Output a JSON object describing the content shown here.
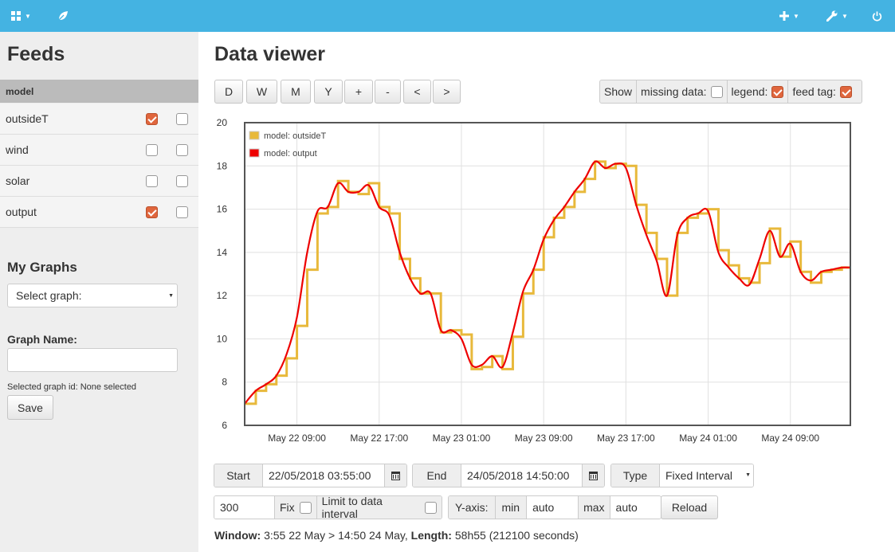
{
  "topbar": {
    "left_icons": [
      "dashboard-grid-icon",
      "leaf-icon"
    ],
    "right_icons": [
      "plus-icon",
      "wrench-icon",
      "power-icon"
    ]
  },
  "sidebar": {
    "title": "Feeds",
    "group": "model",
    "feeds": [
      {
        "name": "outsideT",
        "left_checked": true,
        "right_checked": false
      },
      {
        "name": "wind",
        "left_checked": false,
        "right_checked": false
      },
      {
        "name": "solar",
        "left_checked": false,
        "right_checked": false
      },
      {
        "name": "output",
        "left_checked": true,
        "right_checked": false
      }
    ],
    "my_graphs_title": "My Graphs",
    "select_graph_value": "Select graph:",
    "graph_name_label": "Graph Name:",
    "graph_name_value": "",
    "selected_graph_id": "Selected graph id: None selected",
    "save_label": "Save"
  },
  "main": {
    "title": "Data viewer",
    "range_buttons": [
      "D",
      "W",
      "M",
      "Y",
      "+",
      "-",
      "<",
      ">"
    ],
    "show_label": "Show",
    "missing_data_label": "missing data:",
    "missing_data_checked": false,
    "legend_label": "legend:",
    "legend_checked": true,
    "feed_tag_label": "feed tag:",
    "feed_tag_checked": true
  },
  "chart_data": {
    "type": "line",
    "title": "",
    "xlabel": "",
    "ylabel": "",
    "ylim": [
      6,
      20
    ],
    "yticks": [
      6,
      8,
      10,
      12,
      14,
      16,
      18,
      20
    ],
    "xlim": [
      "May 22 03:55",
      "May 24 14:50"
    ],
    "xticks": [
      "May 22 09:00",
      "May 22 17:00",
      "May 23 01:00",
      "May 23 09:00",
      "May 23 17:00",
      "May 24 01:00",
      "May 24 09:00"
    ],
    "legend_position": "top-left",
    "grid": true,
    "series": [
      {
        "name": "model: outsideT",
        "color": "#e8b93b",
        "style": "step",
        "x": [
          "May 22 03:55",
          "May 22 05:00",
          "May 22 06:00",
          "May 22 07:00",
          "May 22 08:00",
          "May 22 09:00",
          "May 22 10:00",
          "May 22 11:00",
          "May 22 12:00",
          "May 22 13:00",
          "May 22 14:00",
          "May 22 15:00",
          "May 22 16:00",
          "May 22 17:00",
          "May 22 18:00",
          "May 22 19:00",
          "May 22 20:00",
          "May 22 21:00",
          "May 22 22:00",
          "May 22 23:00",
          "May 23 00:00",
          "May 23 01:00",
          "May 23 02:00",
          "May 23 03:00",
          "May 23 04:00",
          "May 23 05:00",
          "May 23 06:00",
          "May 23 07:00",
          "May 23 08:00",
          "May 23 09:00",
          "May 23 10:00",
          "May 23 11:00",
          "May 23 12:00",
          "May 23 13:00",
          "May 23 14:00",
          "May 23 15:00",
          "May 23 16:00",
          "May 23 17:00",
          "May 23 18:00",
          "May 23 19:00",
          "May 23 20:00",
          "May 23 21:00",
          "May 23 22:00",
          "May 23 23:00",
          "May 24 00:00",
          "May 24 01:00",
          "May 24 02:00",
          "May 24 03:00",
          "May 24 04:00",
          "May 24 05:00",
          "May 24 06:00",
          "May 24 07:00",
          "May 24 08:00",
          "May 24 09:00",
          "May 24 10:00",
          "May 24 11:00",
          "May 24 12:00",
          "May 24 13:00",
          "May 24 14:00",
          "May 24 14:50"
        ],
        "y": [
          7.0,
          7.6,
          7.9,
          8.3,
          9.1,
          10.6,
          13.2,
          15.8,
          16.1,
          17.3,
          16.8,
          16.7,
          17.2,
          16.1,
          15.8,
          13.7,
          12.8,
          12.1,
          12.1,
          10.3,
          10.4,
          10.2,
          8.6,
          8.7,
          9.2,
          8.6,
          10.1,
          12.1,
          13.2,
          14.7,
          15.6,
          16.1,
          16.8,
          17.4,
          18.2,
          17.9,
          18.1,
          18.0,
          16.2,
          14.9,
          13.7,
          12.0,
          14.9,
          15.6,
          15.8,
          16.0,
          14.1,
          13.4,
          12.8,
          12.6,
          13.5,
          15.1,
          13.8,
          14.5,
          13.1,
          12.6,
          13.1,
          13.2,
          13.3,
          13.3
        ]
      },
      {
        "name": "model: output",
        "color": "#ee0000",
        "style": "line",
        "x": [
          "May 22 03:55",
          "May 22 05:00",
          "May 22 06:00",
          "May 22 07:00",
          "May 22 08:00",
          "May 22 09:00",
          "May 22 10:00",
          "May 22 11:00",
          "May 22 12:00",
          "May 22 13:00",
          "May 22 14:00",
          "May 22 15:00",
          "May 22 16:00",
          "May 22 17:00",
          "May 22 18:00",
          "May 22 19:00",
          "May 22 20:00",
          "May 22 21:00",
          "May 22 22:00",
          "May 22 23:00",
          "May 23 00:00",
          "May 23 01:00",
          "May 23 02:00",
          "May 23 03:00",
          "May 23 04:00",
          "May 23 05:00",
          "May 23 06:00",
          "May 23 07:00",
          "May 23 08:00",
          "May 23 09:00",
          "May 23 10:00",
          "May 23 11:00",
          "May 23 12:00",
          "May 23 13:00",
          "May 23 14:00",
          "May 23 15:00",
          "May 23 16:00",
          "May 23 17:00",
          "May 23 18:00",
          "May 23 19:00",
          "May 23 20:00",
          "May 23 21:00",
          "May 23 22:00",
          "May 23 23:00",
          "May 24 00:00",
          "May 24 01:00",
          "May 24 02:00",
          "May 24 03:00",
          "May 24 04:00",
          "May 24 05:00",
          "May 24 06:00",
          "May 24 07:00",
          "May 24 08:00",
          "May 24 09:00",
          "May 24 10:00",
          "May 24 11:00",
          "May 24 12:00",
          "May 24 13:00",
          "May 24 14:00",
          "May 24 14:50"
        ],
        "y": [
          7.0,
          7.6,
          7.9,
          8.3,
          9.3,
          11.0,
          14.0,
          15.9,
          16.1,
          17.2,
          16.8,
          16.8,
          17.1,
          16.1,
          15.7,
          14.0,
          12.8,
          12.1,
          12.1,
          10.4,
          10.4,
          10.0,
          8.8,
          8.8,
          9.2,
          8.7,
          10.3,
          12.2,
          13.2,
          14.6,
          15.5,
          16.1,
          16.8,
          17.4,
          18.2,
          17.9,
          18.1,
          17.9,
          16.2,
          14.8,
          13.6,
          12.0,
          14.8,
          15.6,
          15.8,
          15.9,
          14.0,
          13.3,
          12.8,
          12.5,
          13.7,
          15.0,
          13.8,
          14.4,
          13.1,
          12.7,
          13.1,
          13.2,
          13.3,
          13.3
        ]
      }
    ]
  },
  "controls": {
    "start_label": "Start",
    "start_value": "22/05/2018 03:55:00",
    "end_label": "End",
    "end_value": "24/05/2018 14:50:00",
    "type_label": "Type",
    "type_value": "Fixed Interval",
    "interval_value": "300",
    "fix_label": "Fix",
    "fix_checked": false,
    "limit_label": "Limit to data interval",
    "limit_checked": false,
    "yaxis_label": "Y-axis:",
    "min_label": "min",
    "min_value": "auto",
    "max_label": "max",
    "max_value": "auto",
    "reload_label": "Reload"
  },
  "footer": {
    "window_label": "Window:",
    "window_value": " 3:55 22 May > 14:50 24 May, ",
    "length_label": "Length:",
    "length_value": " 58h55 (212100 seconds)"
  }
}
